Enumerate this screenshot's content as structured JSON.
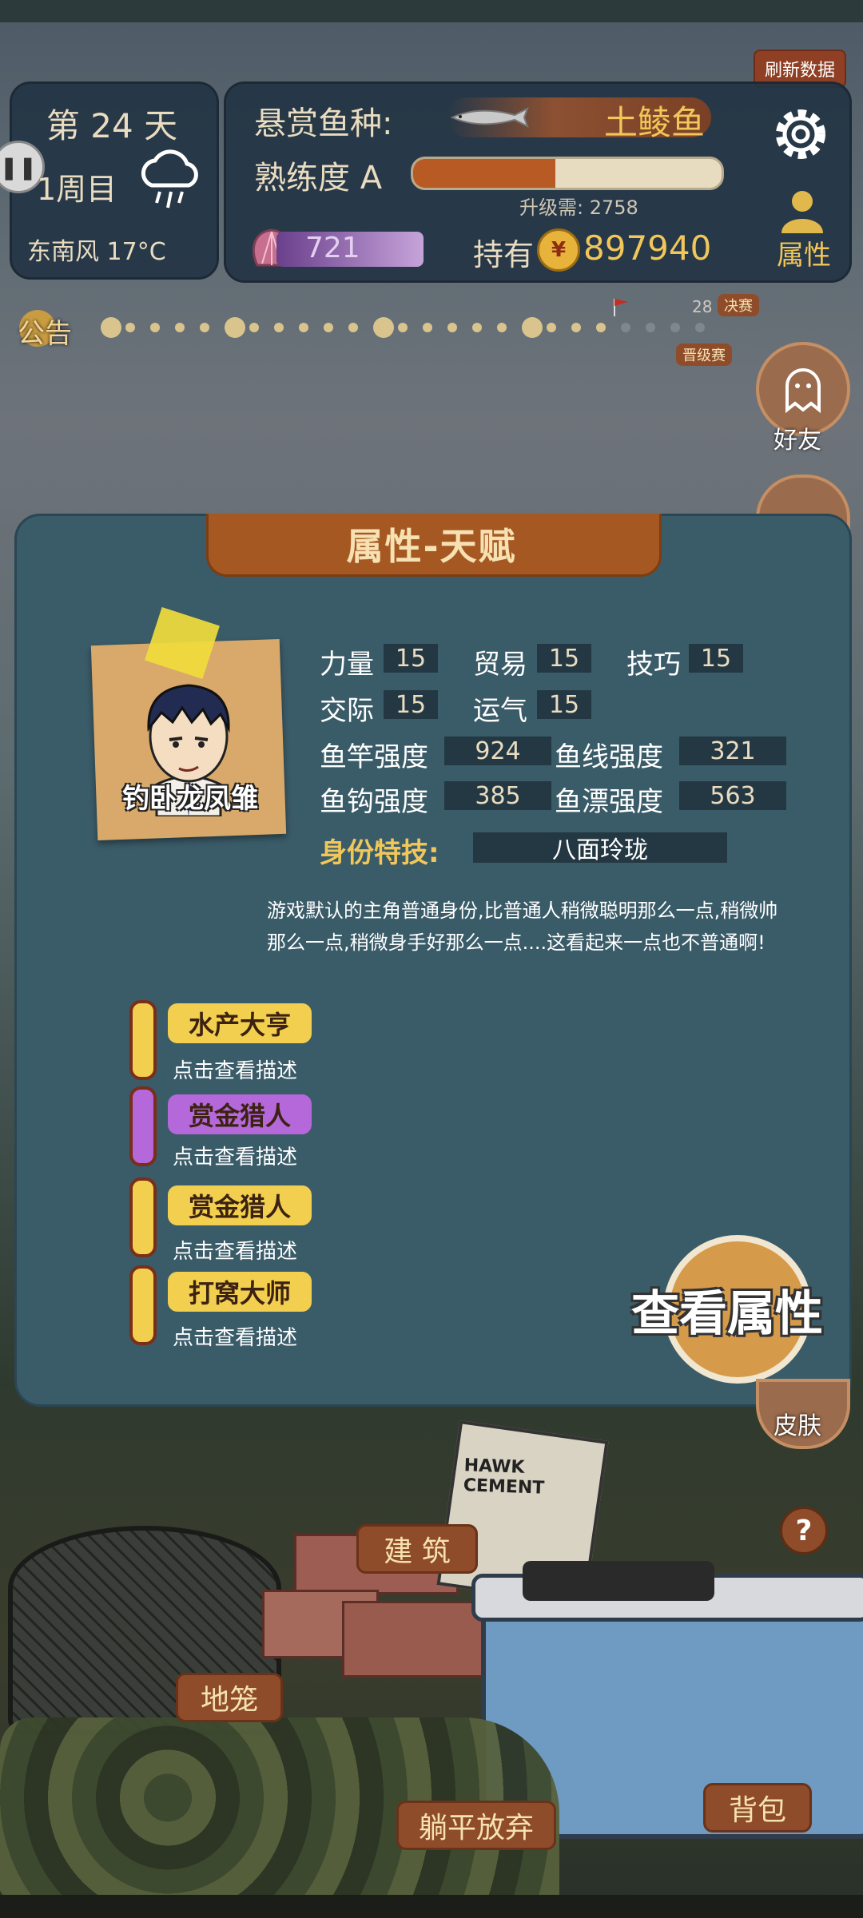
{
  "top": {
    "day_label": "第 24 天",
    "cycle_label": "1周目",
    "weather_label": "东南风 17°C",
    "bounty_label": "悬赏鱼种:",
    "bounty_fish": "土鲮鱼",
    "proficiency_label": "熟练度 A",
    "proficiency_progress": 0.46,
    "upgrade_label": "升级需: 2758",
    "shell_count": "721",
    "hold_label": "持有",
    "money": "897940",
    "refresh_label": "刷新数据",
    "attr_label": "属性"
  },
  "timeline": {
    "notice_label": "公告",
    "marker_28": "28",
    "final_label": "决赛",
    "promo_label": "晋级赛"
  },
  "side": {
    "friends_label": "好友",
    "skin_label": "皮肤",
    "help_label": "?"
  },
  "panel": {
    "title": "属性-天赋",
    "avatar_name": "钓卧龙凤雏",
    "stats": {
      "strength_label": "力量",
      "strength": "15",
      "trade_label": "贸易",
      "trade": "15",
      "skill_label": "技巧",
      "skill": "15",
      "social_label": "交际",
      "social": "15",
      "luck_label": "运气",
      "luck": "15",
      "rod_label": "鱼竿强度",
      "rod": "924",
      "line_label": "鱼线强度",
      "line": "321",
      "hook_label": "鱼钩强度",
      "hook": "385",
      "float_label": "鱼漂强度",
      "float": "563"
    },
    "identity_label": "身份特技:",
    "identity_value": "八面玲珑",
    "description_line1": "游戏默认的主角普通身份,比普通人稍微聪明那么一点,稍微帅",
    "description_line2": "那么一点,稍微身手好那么一点....这看起来一点也不普通啊!",
    "talents": [
      {
        "name": "水产大亨",
        "sub": "点击查看描述",
        "color": "#f3cf4f"
      },
      {
        "name": "赏金猎人",
        "sub": "点击查看描述",
        "color": "#b468d9"
      },
      {
        "name": "赏金猎人",
        "sub": "点击查看描述",
        "color": "#f3cf4f"
      },
      {
        "name": "打窝大师",
        "sub": "点击查看描述",
        "color": "#f3cf4f"
      }
    ],
    "view_attr_button": "查看属性"
  },
  "bottom": {
    "build_label": "建 筑",
    "cage_label": "地笼",
    "give_up_label": "躺平放弃",
    "bag_label": "背包",
    "cement_text": "HAWK CEMENT"
  },
  "colors": {
    "panel": "#3a5b68",
    "accent": "#a65823",
    "gold": "#f1c75a"
  }
}
